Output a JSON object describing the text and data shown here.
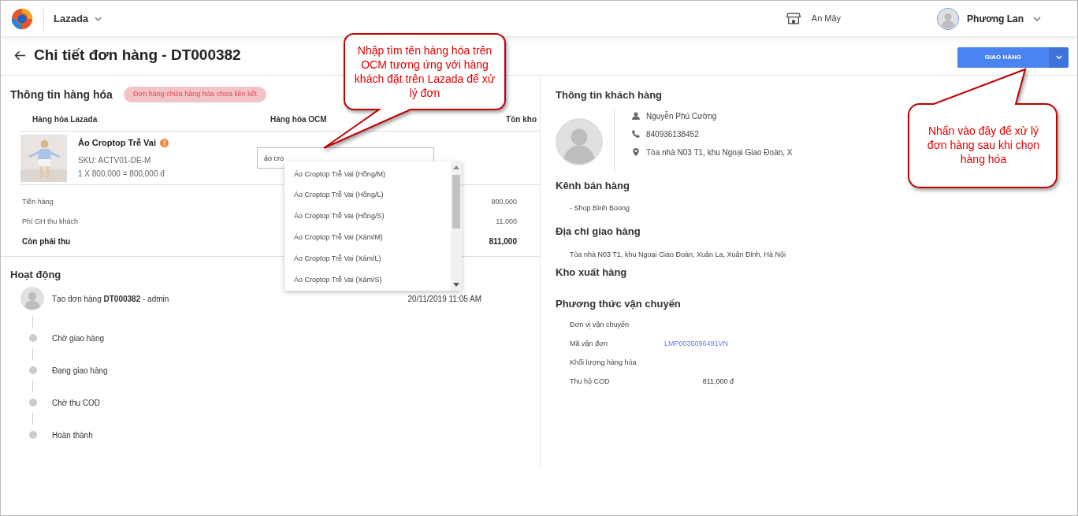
{
  "header": {
    "brand": "Lazada",
    "store": "An Mây",
    "user": "Phương Lan"
  },
  "page": {
    "title": "Chi tiết đơn hàng - DT000382",
    "primary_button": "GIAO HÀNG"
  },
  "products": {
    "heading": "Thông tin hàng hóa",
    "badge": "Đơn hàng chứa hàng hóa chưa liên kết",
    "columns": [
      "Hàng hóa Lazada",
      "Hàng hóa OCM",
      "Tồn kho"
    ],
    "item": {
      "name": "Áo Croptop Trễ Vai",
      "warning": true,
      "sku": "SKU: ACTV01-DE-M",
      "price_line": "1 X 800,000 = 800,000 đ",
      "search_value": "áo cro"
    },
    "suggestions": [
      "Áo Croptop Trễ Vai (Hồng/M)",
      "Áo Croptop Trễ Vai (Hồng/L)",
      "Áo Croptop Trễ Vai (Hồng/S)",
      "Áo Croptop Trễ Vai (Xám/M)",
      "Áo Croptop Trễ Vai (Xám/L)",
      "Áo Croptop Trễ Vai (Xám/S)"
    ],
    "totals": [
      {
        "label": "Tiền hàng",
        "value": "800,000",
        "bold": false
      },
      {
        "label": "Phí GH thu khách",
        "value": "11,000",
        "bold": false
      },
      {
        "label": "Còn phải thu",
        "value": "811,000",
        "bold": true
      }
    ]
  },
  "activity": {
    "heading": "Hoạt động",
    "events": [
      {
        "kind": "created",
        "text": "Tạo đơn hàng **DT000382** - admin",
        "time": "20/11/2019 11:05 AM"
      },
      {
        "kind": "step",
        "text": "Chờ giao hàng"
      },
      {
        "kind": "step",
        "text": "Đang giao hàng"
      },
      {
        "kind": "step",
        "text": "Chờ thu COD"
      },
      {
        "kind": "step",
        "text": "Hoàn thành"
      }
    ]
  },
  "customer": {
    "heading": "Thông tin khách hàng",
    "contacts": [
      {
        "kind": "person",
        "text": "Nguyễn Phú Cường"
      },
      {
        "kind": "phone",
        "text": "840936138452"
      },
      {
        "kind": "location",
        "text": "Tòa nhà N03 T1, khu Ngoại Giao Đoàn, X"
      }
    ]
  },
  "sales_channel": {
    "heading": "Kênh bán hàng",
    "text": "- Shop Bình Boong"
  },
  "delivery_address": {
    "heading": "Địa chỉ giao hàng",
    "text": "Tòa nhà N03 T1, khu Ngoại Giao Đoàn, Xuân La, Xuân Đỉnh, Hà Nội"
  },
  "warehouse": {
    "heading": "Kho xuất hàng"
  },
  "shipping": {
    "heading": "Phương thức vận chuyển",
    "rows": [
      {
        "label": "Đơn vị vận chuyển"
      },
      {
        "label": "Mã vận đơn",
        "value": "LMP0035096491VN",
        "kind": "link"
      },
      {
        "label": "Khối lượng hàng hóa"
      },
      {
        "label": "Thu hộ COD",
        "value": "811,000 đ",
        "kind": "text"
      }
    ]
  },
  "callouts": [
    {
      "text": "Nhập tìm tên hàng hóa trên OCM tương ứng với hàng khách đặt trên Lazada để xử lý đơn"
    },
    {
      "text": "Nhấn vào đây để xử lý đơn hàng sau khi chọn hàng hóa"
    }
  ]
}
